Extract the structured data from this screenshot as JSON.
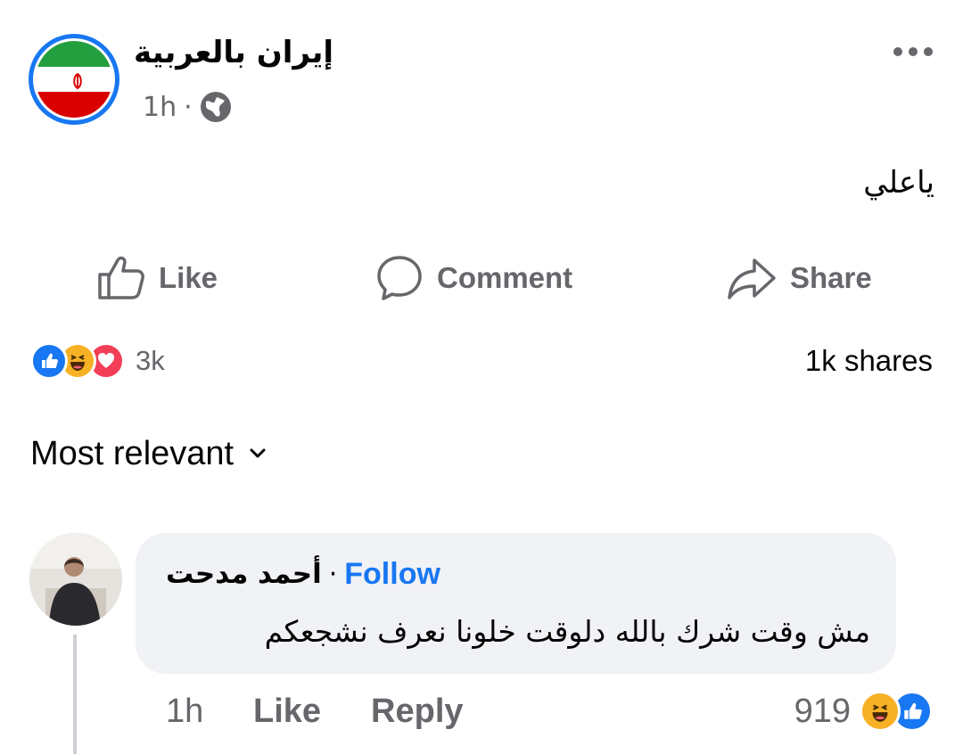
{
  "post": {
    "page_name": "إيران بالعربية",
    "time": "1h",
    "separator": "·",
    "audience_icon": "globe-icon",
    "text": "ياعلي"
  },
  "actions": {
    "like": "Like",
    "comment": "Comment",
    "share": "Share"
  },
  "stats": {
    "reaction_icons": [
      "like-reaction-icon",
      "haha-reaction-icon",
      "love-reaction-icon"
    ],
    "reaction_count": "3k",
    "shares": "1k shares"
  },
  "comments_sort": {
    "label": "Most relevant"
  },
  "comment": {
    "author": "أحمد مدحت",
    "separator": "·",
    "follow": "Follow",
    "text": "مش وقت شرك بالله دلوقت خلونا نعرف نشجعكم",
    "time": "1h",
    "like": "Like",
    "reply": "Reply",
    "reaction_count": "919",
    "reaction_icons": [
      "haha-reaction-icon",
      "like-reaction-icon"
    ]
  },
  "colors": {
    "accent": "#1877f2",
    "secondary_text": "#65676b",
    "bubble": "#f0f2f5",
    "flag_green": "#239f40",
    "flag_red": "#da0000",
    "love": "#f33e58",
    "haha": "#f7b125"
  }
}
